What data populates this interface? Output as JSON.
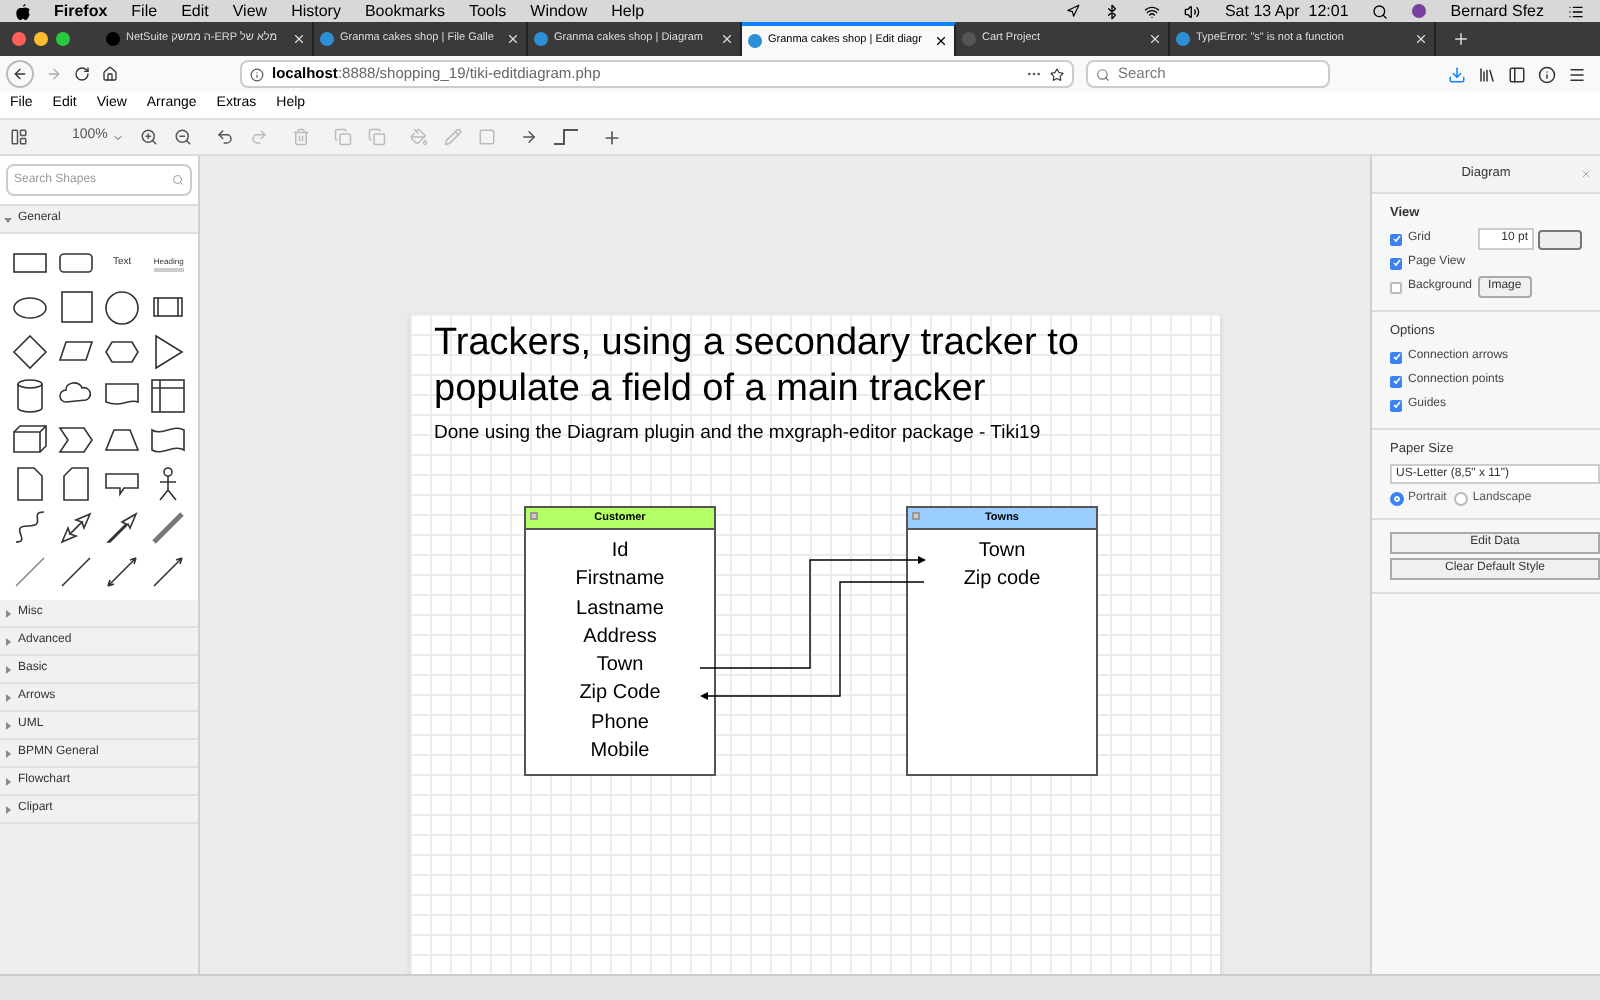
{
  "menubar": {
    "app": "Firefox",
    "items": [
      "File",
      "Edit",
      "View",
      "History",
      "Bookmarks",
      "Tools",
      "Window",
      "Help"
    ],
    "clock": "Sat 13 Apr  12:01",
    "user": "Bernard Sfez"
  },
  "tabs": [
    {
      "title": "NetSuite ה ממשק-ERP מלא של",
      "selected": false
    },
    {
      "title": "Granma cakes shop | File Galle",
      "selected": false
    },
    {
      "title": "Granma cakes shop | Diagram",
      "selected": false
    },
    {
      "title": "Granma cakes shop | Edit diagr",
      "selected": true
    },
    {
      "title": "Cart Project",
      "selected": false
    },
    {
      "title": "TypeError: \"s\" is not a function",
      "selected": false
    }
  ],
  "address_bar": {
    "url_host": "localhost",
    "url_rest": ":8888/shopping_19/tiki-editdiagram.php",
    "search": {
      "placeholder": "Search"
    }
  },
  "app_menu": [
    "File",
    "Edit",
    "View",
    "Arrange",
    "Extras",
    "Help"
  ],
  "toolbar": {
    "zoom": "100%"
  },
  "sidebar": {
    "search": {
      "placeholder": "Search Shapes"
    },
    "sections": [
      {
        "label": "General",
        "expanded": true
      },
      {
        "label": "Misc",
        "expanded": false
      },
      {
        "label": "Advanced",
        "expanded": false
      },
      {
        "label": "Basic",
        "expanded": false
      },
      {
        "label": "Arrows",
        "expanded": false
      },
      {
        "label": "UML",
        "expanded": false
      },
      {
        "label": "BPMN General",
        "expanded": false
      },
      {
        "label": "Flowchart",
        "expanded": false
      },
      {
        "label": "Clipart",
        "expanded": false
      }
    ],
    "shapes": [
      {
        "kind": "rect"
      },
      {
        "kind": "rounded"
      },
      {
        "kind": "text",
        "label": "Text"
      },
      {
        "kind": "heading",
        "label": "Heading"
      },
      {
        "kind": "ellipse"
      },
      {
        "kind": "square"
      },
      {
        "kind": "circle"
      },
      {
        "kind": "process"
      },
      {
        "kind": "diamond"
      },
      {
        "kind": "parallelogram"
      },
      {
        "kind": "hexagon"
      },
      {
        "kind": "triangle"
      },
      {
        "kind": "cylinder"
      },
      {
        "kind": "cloud"
      },
      {
        "kind": "document"
      },
      {
        "kind": "internal"
      },
      {
        "kind": "cube"
      },
      {
        "kind": "step"
      },
      {
        "kind": "trapezoid"
      },
      {
        "kind": "tape"
      },
      {
        "kind": "note"
      },
      {
        "kind": "card"
      },
      {
        "kind": "callout"
      },
      {
        "kind": "actor"
      },
      {
        "kind": "curve"
      },
      {
        "kind": "bidirectional"
      },
      {
        "kind": "arrow"
      },
      {
        "kind": "link"
      },
      {
        "kind": "line"
      },
      {
        "kind": "thickline"
      },
      {
        "kind": "doubleconnector"
      },
      {
        "kind": "connector"
      }
    ]
  },
  "diagram": {
    "title": "Trackers, using a secondary tracker to populate a field of a main tracker",
    "subtitle": "Done using the Diagram plugin and the mxgraph-editor package - Tiki19",
    "tables": [
      {
        "name": "Customer",
        "color": "#b3ff66",
        "fields": [
          "Id",
          "Firstname",
          "Lastname",
          "Address",
          "Town",
          "Zip Code",
          "Phone",
          "Mobile"
        ]
      },
      {
        "name": "Towns",
        "color": "#99ccff",
        "fields": [
          "Town",
          "Zip code"
        ]
      }
    ]
  },
  "format_panel": {
    "title": "Diagram",
    "view": {
      "heading": "View",
      "items": [
        {
          "label": "Grid",
          "checked": true
        },
        {
          "label": "Page View",
          "checked": true
        },
        {
          "label": "Background",
          "checked": false
        }
      ],
      "grid_size": "10 pt",
      "image_button": "Image"
    },
    "options": {
      "heading": "Options",
      "items": [
        {
          "label": "Connection arrows",
          "checked": true
        },
        {
          "label": "Connection points",
          "checked": true
        },
        {
          "label": "Guides",
          "checked": true
        }
      ]
    },
    "paper": {
      "heading": "Paper Size",
      "value": "US-Letter (8,5\" x 11\")",
      "orientations": [
        {
          "label": "Portrait",
          "selected": true
        },
        {
          "label": "Landscape",
          "selected": false
        }
      ]
    },
    "buttons": [
      "Edit Data",
      "Clear Default Style"
    ]
  }
}
